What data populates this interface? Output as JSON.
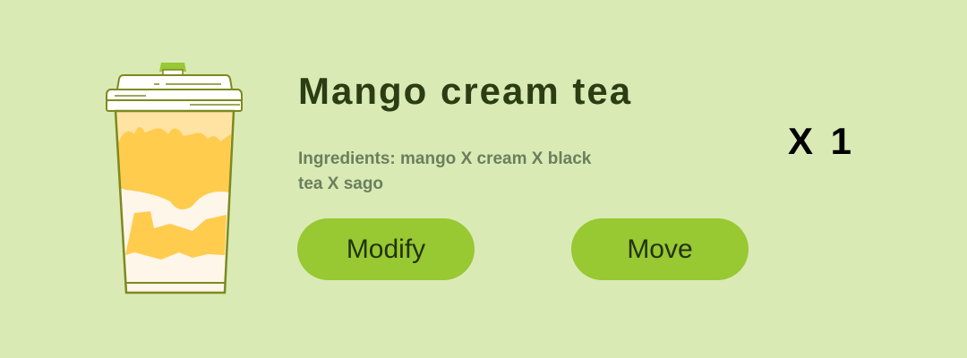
{
  "item": {
    "name": "Mango cream tea",
    "ingredients": "Ingredients: mango X cream X black tea X sago",
    "quantity": "X 1",
    "image_icon": "bubble-tea-cup-icon"
  },
  "actions": {
    "modify_label": "Modify",
    "move_label": "Move"
  },
  "colors": {
    "background": "#d9eab5",
    "button": "#98c832",
    "title": "#2b3d12",
    "ingredients": "#6b7f5c",
    "cup_outline": "#7d8a1e",
    "mango": "#ffcc4d",
    "cream": "#fff6ea"
  }
}
